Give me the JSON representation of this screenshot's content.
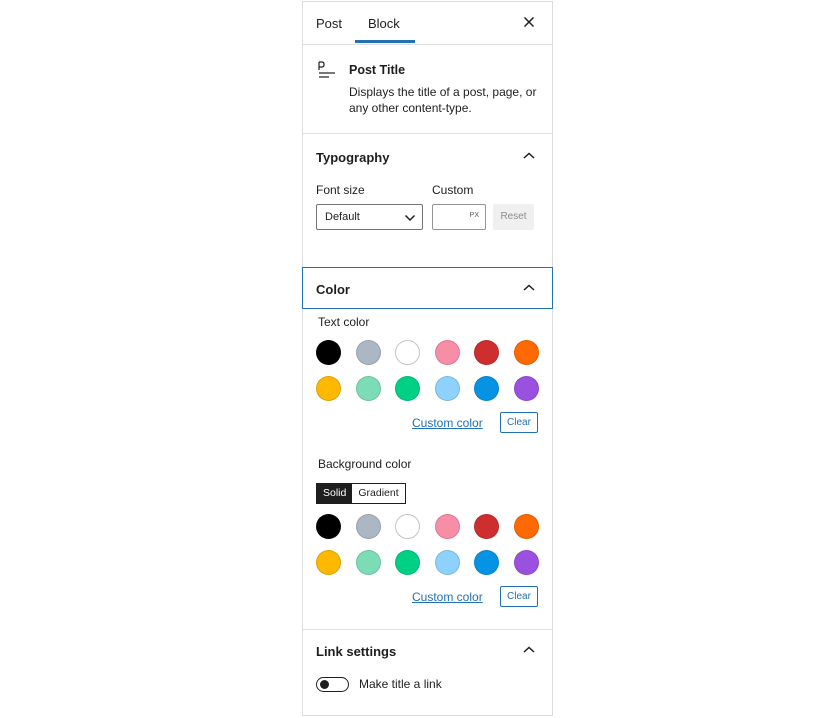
{
  "tabs": {
    "post_label": "Post",
    "block_label": "Block",
    "active": "Block"
  },
  "block": {
    "name": "Post Title",
    "description": "Displays the title of a post, page, or any other content-type.",
    "icon": "post-title-icon"
  },
  "typography": {
    "title": "Typography",
    "font_size_label": "Font size",
    "custom_label": "Custom",
    "font_size_value": "Default",
    "custom_value": "",
    "unit": "PX",
    "reset_label": "Reset"
  },
  "color": {
    "title": "Color",
    "text_color_label": "Text color",
    "background_color_label": "Background color",
    "custom_color_label": "Custom color",
    "clear_label": "Clear",
    "solid_label": "Solid",
    "gradient_label": "Gradient",
    "palette": [
      "#000000",
      "#abb8c3",
      "#ffffff",
      "#f78da7",
      "#cf2e2e",
      "#ff6900",
      "#fcb900",
      "#7bdcb5",
      "#00d084",
      "#8ed1fc",
      "#0693e3",
      "#9b51e0"
    ],
    "accent": "#2271b1"
  },
  "link_settings": {
    "title": "Link settings",
    "toggle_label": "Make title a link",
    "toggle_on": false
  }
}
